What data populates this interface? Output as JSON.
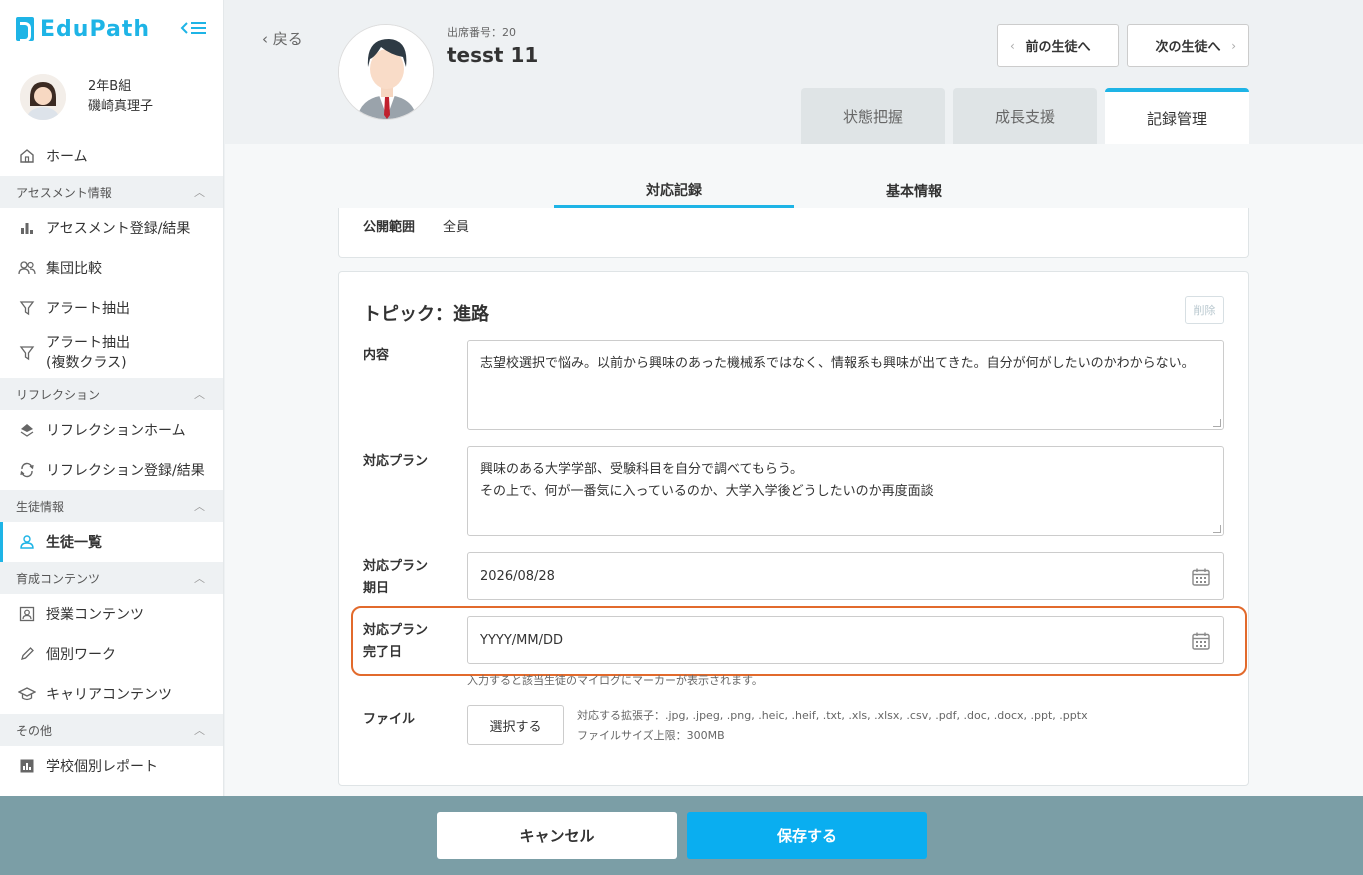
{
  "app": {
    "logo": "EduPath"
  },
  "user": {
    "class": "2年B組",
    "name": "磯崎真理子"
  },
  "sidebar": {
    "home": "ホーム",
    "sections": [
      {
        "title": "アセスメント情報",
        "items": [
          "アセスメント登録/結果",
          "集団比較",
          "アラート抽出",
          "アラート抽出\n(複数クラス)"
        ]
      },
      {
        "title": "リフレクション",
        "items": [
          "リフレクションホーム",
          "リフレクション登録/結果"
        ]
      },
      {
        "title": "生徒情報",
        "items": [
          "生徒一覧"
        ]
      },
      {
        "title": "育成コンテンツ",
        "items": [
          "授業コンテンツ",
          "個別ワーク",
          "キャリアコンテンツ"
        ]
      },
      {
        "title": "その他",
        "items": [
          "学校個別レポート"
        ]
      }
    ]
  },
  "header": {
    "back": "戻る",
    "seat_no": "出席番号：20",
    "student_name": "tesst 11",
    "prev_student": "前の生徒へ",
    "next_student": "次の生徒へ",
    "tabs": [
      "状態把握",
      "成長支援",
      "記録管理"
    ]
  },
  "subtabs": [
    "対応記録",
    "基本情報"
  ],
  "record": {
    "visibility_label": "公開範囲",
    "visibility_value": "全員",
    "topic_title": "トピック：進路",
    "delete": "削除",
    "content_label": "内容",
    "content_value": "志望校選択で悩み。以前から興味のあった機械系ではなく、情報系も興味が出てきた。自分が何がしたいのかわからない。",
    "plan_label": "対応プラン",
    "plan_line1": "興味のある大学学部、受験科目を自分で調べてもらう。",
    "plan_line2": "その上で、何が一番気に入っているのか、大学入学後どうしたいのか再度面談",
    "due_label_1": "対応プラン",
    "due_label_2": "期日",
    "due_value": "2026/08/28",
    "done_label_1": "対応プラン",
    "done_label_2": "完了日",
    "done_placeholder": "YYYY/MM/DD",
    "done_hint": "入力すると該当生徒のマイログにマーカーが表示されます。",
    "file_label": "ファイル",
    "file_button": "選択する",
    "file_ext": "対応する拡張子：.jpg, .jpeg, .png, .heic, .heif, .txt, .xls, .xlsx, .csv, .pdf, .doc, .docx, .ppt, .pptx",
    "file_size": "ファイルサイズ上限：300MB"
  },
  "footer": {
    "cancel": "キャンセル",
    "save": "保存する"
  }
}
